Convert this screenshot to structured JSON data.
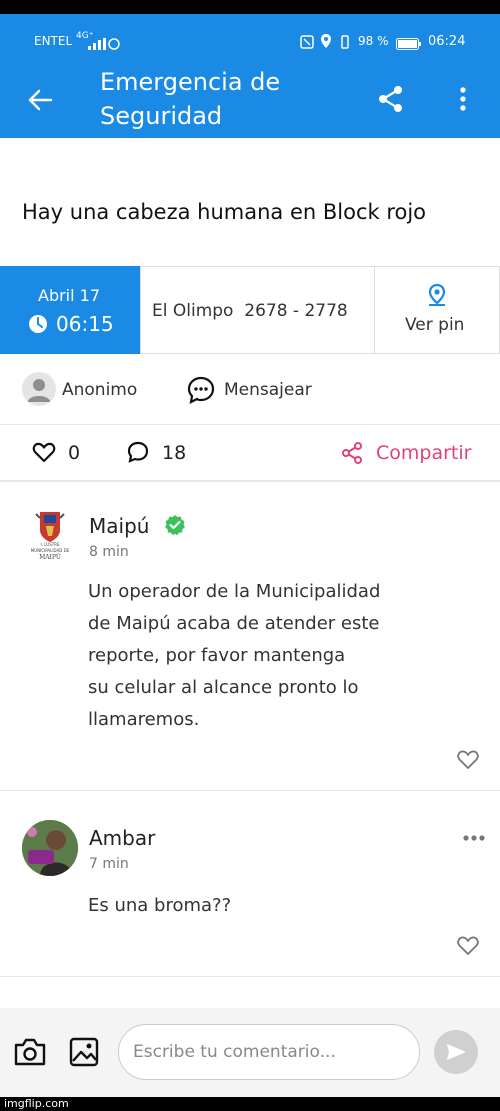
{
  "status_bar": {
    "carrier": "ENTEL",
    "network": "4G⁺",
    "battery_percent": "98 %",
    "time": "06:24"
  },
  "appbar": {
    "title_line1": "Emergencia de",
    "title_line2": "Seguridad",
    "back_icon": "arrow-left-icon",
    "share_icon": "share-icon",
    "menu_icon": "more-vert-icon"
  },
  "report": {
    "headline": "Hay una cabeza humana en Block rojo",
    "date": "Abril 17",
    "time": "06:15",
    "address": "El Olimpo  2678 - 2778",
    "pin_label": "Ver pin",
    "author_label": "Anonimo",
    "message_label": "Mensajear",
    "likes": "0",
    "comments": "18",
    "share_label": "Compartir",
    "colors": {
      "primary": "#1a8ae4",
      "accent_pink": "#e0437a"
    }
  },
  "comments": [
    {
      "author": "Maipú",
      "verified": true,
      "time": "8 min",
      "text_lines": [
        "Un operador de la Municipalidad",
        "de Maipú acaba de atender este",
        "reporte, por favor mantenga",
        "su celular al alcance pronto lo",
        "llamaremos."
      ],
      "avatar_caption_line1": "I. LUSTRE",
      "avatar_caption_line2": "MUNICIPALIDAD DE",
      "avatar_caption_line3": "MAIPÚ"
    },
    {
      "author": "Ambar",
      "time": "7 min",
      "text": "Es una broma??"
    }
  ],
  "composer": {
    "placeholder": "Escribe tu comentario..."
  },
  "watermark": "imgflip.com"
}
